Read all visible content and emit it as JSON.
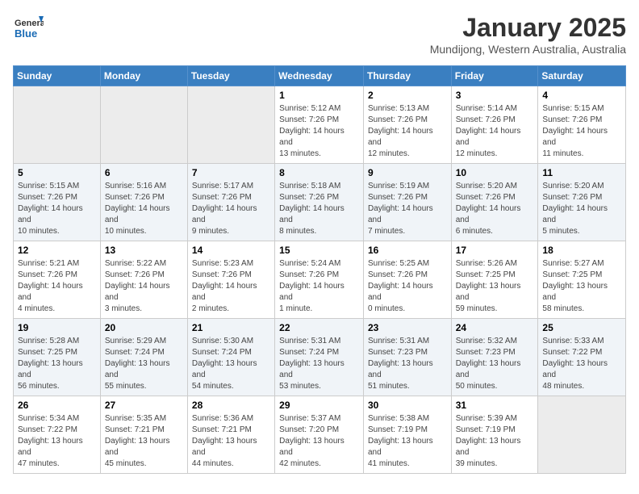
{
  "header": {
    "logo": "GeneralBlue",
    "title": "January 2025",
    "location": "Mundijong, Western Australia, Australia"
  },
  "weekdays": [
    "Sunday",
    "Monday",
    "Tuesday",
    "Wednesday",
    "Thursday",
    "Friday",
    "Saturday"
  ],
  "weeks": [
    [
      {
        "day": null
      },
      {
        "day": null
      },
      {
        "day": null
      },
      {
        "day": "1",
        "sunrise": "5:12 AM",
        "sunset": "7:26 PM",
        "daylight": "14 hours and 13 minutes."
      },
      {
        "day": "2",
        "sunrise": "5:13 AM",
        "sunset": "7:26 PM",
        "daylight": "14 hours and 12 minutes."
      },
      {
        "day": "3",
        "sunrise": "5:14 AM",
        "sunset": "7:26 PM",
        "daylight": "14 hours and 12 minutes."
      },
      {
        "day": "4",
        "sunrise": "5:15 AM",
        "sunset": "7:26 PM",
        "daylight": "14 hours and 11 minutes."
      }
    ],
    [
      {
        "day": "5",
        "sunrise": "5:15 AM",
        "sunset": "7:26 PM",
        "daylight": "14 hours and 10 minutes."
      },
      {
        "day": "6",
        "sunrise": "5:16 AM",
        "sunset": "7:26 PM",
        "daylight": "14 hours and 10 minutes."
      },
      {
        "day": "7",
        "sunrise": "5:17 AM",
        "sunset": "7:26 PM",
        "daylight": "14 hours and 9 minutes."
      },
      {
        "day": "8",
        "sunrise": "5:18 AM",
        "sunset": "7:26 PM",
        "daylight": "14 hours and 8 minutes."
      },
      {
        "day": "9",
        "sunrise": "5:19 AM",
        "sunset": "7:26 PM",
        "daylight": "14 hours and 7 minutes."
      },
      {
        "day": "10",
        "sunrise": "5:20 AM",
        "sunset": "7:26 PM",
        "daylight": "14 hours and 6 minutes."
      },
      {
        "day": "11",
        "sunrise": "5:20 AM",
        "sunset": "7:26 PM",
        "daylight": "14 hours and 5 minutes."
      }
    ],
    [
      {
        "day": "12",
        "sunrise": "5:21 AM",
        "sunset": "7:26 PM",
        "daylight": "14 hours and 4 minutes."
      },
      {
        "day": "13",
        "sunrise": "5:22 AM",
        "sunset": "7:26 PM",
        "daylight": "14 hours and 3 minutes."
      },
      {
        "day": "14",
        "sunrise": "5:23 AM",
        "sunset": "7:26 PM",
        "daylight": "14 hours and 2 minutes."
      },
      {
        "day": "15",
        "sunrise": "5:24 AM",
        "sunset": "7:26 PM",
        "daylight": "14 hours and 1 minute."
      },
      {
        "day": "16",
        "sunrise": "5:25 AM",
        "sunset": "7:26 PM",
        "daylight": "14 hours and 0 minutes."
      },
      {
        "day": "17",
        "sunrise": "5:26 AM",
        "sunset": "7:25 PM",
        "daylight": "13 hours and 59 minutes."
      },
      {
        "day": "18",
        "sunrise": "5:27 AM",
        "sunset": "7:25 PM",
        "daylight": "13 hours and 58 minutes."
      }
    ],
    [
      {
        "day": "19",
        "sunrise": "5:28 AM",
        "sunset": "7:25 PM",
        "daylight": "13 hours and 56 minutes."
      },
      {
        "day": "20",
        "sunrise": "5:29 AM",
        "sunset": "7:24 PM",
        "daylight": "13 hours and 55 minutes."
      },
      {
        "day": "21",
        "sunrise": "5:30 AM",
        "sunset": "7:24 PM",
        "daylight": "13 hours and 54 minutes."
      },
      {
        "day": "22",
        "sunrise": "5:31 AM",
        "sunset": "7:24 PM",
        "daylight": "13 hours and 53 minutes."
      },
      {
        "day": "23",
        "sunrise": "5:31 AM",
        "sunset": "7:23 PM",
        "daylight": "13 hours and 51 minutes."
      },
      {
        "day": "24",
        "sunrise": "5:32 AM",
        "sunset": "7:23 PM",
        "daylight": "13 hours and 50 minutes."
      },
      {
        "day": "25",
        "sunrise": "5:33 AM",
        "sunset": "7:22 PM",
        "daylight": "13 hours and 48 minutes."
      }
    ],
    [
      {
        "day": "26",
        "sunrise": "5:34 AM",
        "sunset": "7:22 PM",
        "daylight": "13 hours and 47 minutes."
      },
      {
        "day": "27",
        "sunrise": "5:35 AM",
        "sunset": "7:21 PM",
        "daylight": "13 hours and 45 minutes."
      },
      {
        "day": "28",
        "sunrise": "5:36 AM",
        "sunset": "7:21 PM",
        "daylight": "13 hours and 44 minutes."
      },
      {
        "day": "29",
        "sunrise": "5:37 AM",
        "sunset": "7:20 PM",
        "daylight": "13 hours and 42 minutes."
      },
      {
        "day": "30",
        "sunrise": "5:38 AM",
        "sunset": "7:19 PM",
        "daylight": "13 hours and 41 minutes."
      },
      {
        "day": "31",
        "sunrise": "5:39 AM",
        "sunset": "7:19 PM",
        "daylight": "13 hours and 39 minutes."
      },
      {
        "day": null
      }
    ]
  ],
  "labels": {
    "sunrise_prefix": "Sunrise: ",
    "sunset_prefix": "Sunset: ",
    "daylight_label": "Daylight hours"
  }
}
